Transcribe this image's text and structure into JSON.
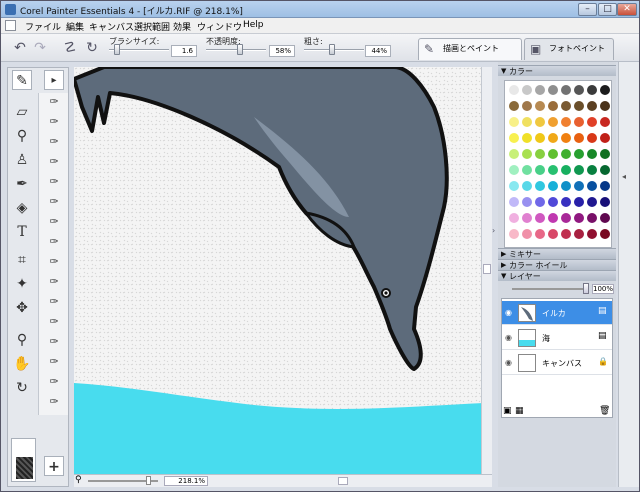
{
  "window": {
    "title": "Corel Painter Essentials 4 - [イルカ.RIF @ 218.1%]",
    "btn_min": "–",
    "btn_max": "□",
    "btn_close": "✕"
  },
  "menu": {
    "items": [
      "ファイル",
      "編集",
      "キャンバス",
      "選択範囲",
      "効果",
      "ウィンドウ",
      "Help"
    ]
  },
  "props": {
    "brush_size_label": "ブラシサイズ:",
    "brush_size_value": "1.6",
    "opacity_label": "不透明度:",
    "opacity_value": "58%",
    "grain_label": "粗さ:",
    "grain_value": "44%"
  },
  "tabs": {
    "paint": "描画とペイント",
    "photo": "フォトペイント"
  },
  "zoom": {
    "value": "218.1%"
  },
  "panels": {
    "color": "カラー",
    "mixer": "ミキサー",
    "colorwheel": "カラー ホイール",
    "layers": "レイヤー",
    "layer_opacity": "100%"
  },
  "layers": [
    {
      "name": "イルカ",
      "selected": true
    },
    {
      "name": "海",
      "selected": false
    },
    {
      "name": "キャンバス",
      "selected": false
    }
  ],
  "colors": {
    "accent": "#3d8ee6",
    "sea": "#48dcee",
    "dolphin": "#5d6b7b",
    "palette": [
      [
        "#e8e8e8",
        "#c8c8c8",
        "#a6a6a6",
        "#8e8e8e",
        "#727272",
        "#565656",
        "#3a3a3a",
        "#1c1c1c"
      ],
      [
        "#8a6a3a",
        "#a0784a",
        "#b78a52",
        "#9a6d3a",
        "#7a5a32",
        "#6b4f2a",
        "#5c4022",
        "#4a321a"
      ],
      [
        "#f8f088",
        "#f0e060",
        "#f0c840",
        "#f0a030",
        "#f08030",
        "#e86030",
        "#e04028",
        "#c82820"
      ],
      [
        "#f8f050",
        "#f0e028",
        "#f0c818",
        "#f0a818",
        "#f08010",
        "#e86010",
        "#d83818",
        "#c02018"
      ],
      [
        "#c8f078",
        "#a8e050",
        "#88d040",
        "#60c030",
        "#40b030",
        "#28a030",
        "#188828",
        "#107020"
      ],
      [
        "#a0f0c0",
        "#70e0a0",
        "#48d088",
        "#28c070",
        "#18b060",
        "#109850",
        "#088040",
        "#066830"
      ],
      [
        "#88e8f0",
        "#58d8e8",
        "#30c8e0",
        "#18b0d8",
        "#1090c8",
        "#1070b8",
        "#0850a0",
        "#063888"
      ],
      [
        "#c0b8f8",
        "#9890f0",
        "#7068e8",
        "#5048d8",
        "#3830c0",
        "#2820a8",
        "#201890",
        "#181078"
      ],
      [
        "#f0b0e0",
        "#e080d0",
        "#d058c0",
        "#c038b0",
        "#a82898",
        "#901880",
        "#781068",
        "#600850"
      ],
      [
        "#f8b8c8",
        "#f090a8",
        "#e86888",
        "#d84868",
        "#c03050",
        "#a82040",
        "#901030",
        "#780820"
      ]
    ]
  }
}
